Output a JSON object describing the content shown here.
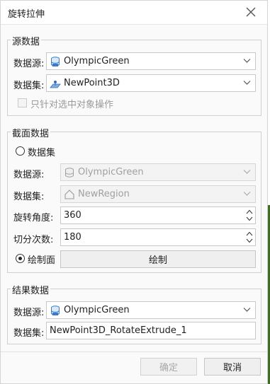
{
  "dialog": {
    "title": "旋转拉伸"
  },
  "source": {
    "legend": "源数据",
    "datasource_label": "数据源:",
    "datasource_value": "OlympicGreen",
    "dataset_label": "数据集:",
    "dataset_value": "NewPoint3D",
    "only_selected_label": "只针对选中对象操作",
    "only_selected_checked": false
  },
  "section": {
    "legend": "截面数据",
    "dataset_radio_label": "数据集",
    "datasource_label": "数据源:",
    "datasource_value": "OlympicGreen",
    "dataset_label": "数据集:",
    "dataset_value": "NewRegion",
    "angle_label": "旋转角度:",
    "angle_value": "360",
    "segments_label": "切分次数:",
    "segments_value": "180",
    "draw_radio_label": "绘制面",
    "draw_button_label": "绘制"
  },
  "result": {
    "legend": "结果数据",
    "datasource_label": "数据源:",
    "datasource_value": "OlympicGreen",
    "dataset_label": "数据集:",
    "dataset_value": "NewPoint3D_RotateExtrude_1"
  },
  "footer": {
    "ok_label": "确定",
    "cancel_label": "取消"
  }
}
